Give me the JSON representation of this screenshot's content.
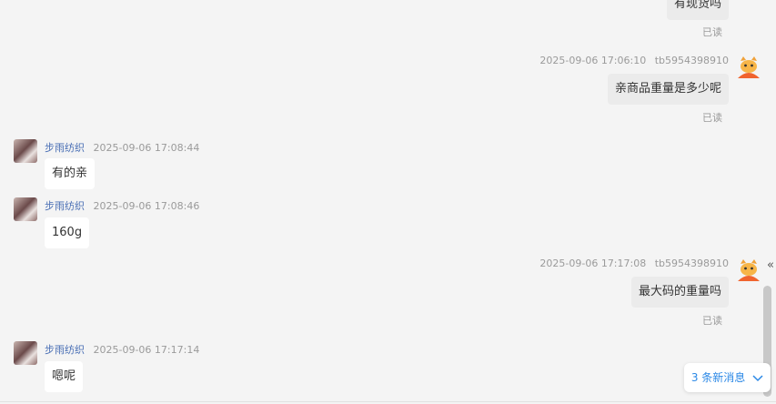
{
  "messages": [
    {
      "dir": "out",
      "text": "有现货吗",
      "read": "已读"
    },
    {
      "dir": "out",
      "time": "2025-09-06 17:06:10",
      "user": "tb5954398910",
      "text": "亲商品重量是多少呢",
      "read": "已读"
    },
    {
      "dir": "in",
      "name": "步雨纺织",
      "time": "2025-09-06 17:08:44",
      "text": "有的亲"
    },
    {
      "dir": "in",
      "name": "步雨纺织",
      "time": "2025-09-06 17:08:46",
      "text": "160g"
    },
    {
      "dir": "out",
      "time": "2025-09-06 17:17:08",
      "user": "tb5954398910",
      "text": "最大码的重量吗",
      "read": "已读"
    },
    {
      "dir": "in",
      "name": "步雨纺织",
      "time": "2025-09-06 17:17:14",
      "text": "嗯呢"
    }
  ],
  "new_messages_label": "3 条新消息",
  "collapse_glyph": "«",
  "colors": {
    "accent": "#2b88e6",
    "name": "#4a6fb5",
    "meta": "#9a9a9a",
    "bubble_out": "#ebebeb",
    "bubble_in": "#ffffff",
    "background": "#f4f4f4"
  },
  "icons": {
    "seller_avatar": "photo-avatar",
    "buyer_avatar": "cartoon-mascot-icon",
    "new_messages": "chevron-down-icon"
  }
}
